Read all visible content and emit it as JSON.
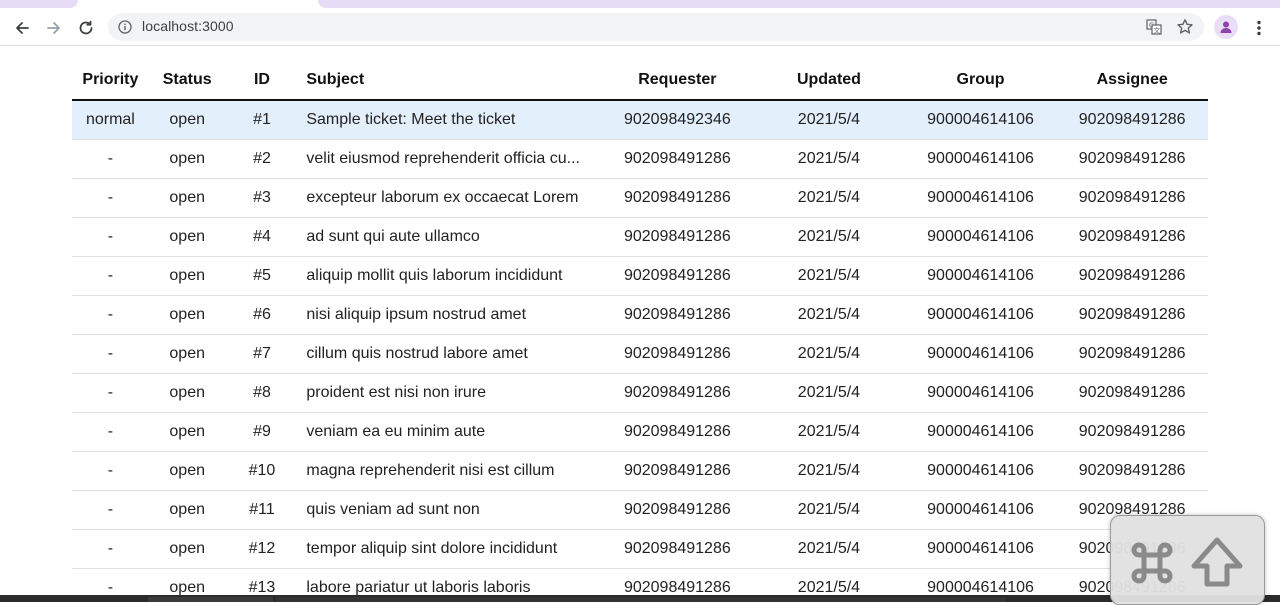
{
  "browser": {
    "url": "localhost:3000",
    "icons": {
      "back": "arrow-left-icon",
      "forward": "arrow-right-icon",
      "reload": "reload-icon",
      "info": "info-icon",
      "translate": "translate-icon",
      "bookmark": "star-icon",
      "profile": "person-icon",
      "menu": "more-vertical-icon"
    }
  },
  "table": {
    "headers": {
      "priority": "Priority",
      "status": "Status",
      "id": "ID",
      "subject": "Subject",
      "requester": "Requester",
      "updated": "Updated",
      "group": "Group",
      "assignee": "Assignee"
    },
    "rows": [
      {
        "priority": "normal",
        "status": "open",
        "id": "#1",
        "subject": "Sample ticket: Meet the ticket",
        "requester": "902098492346",
        "updated": "2021/5/4",
        "group": "900004614106",
        "assignee": "902098491286"
      },
      {
        "priority": "-",
        "status": "open",
        "id": "#2",
        "subject": "velit eiusmod reprehenderit officia cu...",
        "requester": "902098491286",
        "updated": "2021/5/4",
        "group": "900004614106",
        "assignee": "902098491286"
      },
      {
        "priority": "-",
        "status": "open",
        "id": "#3",
        "subject": "excepteur laborum ex occaecat Lorem",
        "requester": "902098491286",
        "updated": "2021/5/4",
        "group": "900004614106",
        "assignee": "902098491286"
      },
      {
        "priority": "-",
        "status": "open",
        "id": "#4",
        "subject": "ad sunt qui aute ullamco",
        "requester": "902098491286",
        "updated": "2021/5/4",
        "group": "900004614106",
        "assignee": "902098491286"
      },
      {
        "priority": "-",
        "status": "open",
        "id": "#5",
        "subject": "aliquip mollit quis laborum incididunt",
        "requester": "902098491286",
        "updated": "2021/5/4",
        "group": "900004614106",
        "assignee": "902098491286"
      },
      {
        "priority": "-",
        "status": "open",
        "id": "#6",
        "subject": "nisi aliquip ipsum nostrud amet",
        "requester": "902098491286",
        "updated": "2021/5/4",
        "group": "900004614106",
        "assignee": "902098491286"
      },
      {
        "priority": "-",
        "status": "open",
        "id": "#7",
        "subject": "cillum quis nostrud labore amet",
        "requester": "902098491286",
        "updated": "2021/5/4",
        "group": "900004614106",
        "assignee": "902098491286"
      },
      {
        "priority": "-",
        "status": "open",
        "id": "#8",
        "subject": "proident est nisi non irure",
        "requester": "902098491286",
        "updated": "2021/5/4",
        "group": "900004614106",
        "assignee": "902098491286"
      },
      {
        "priority": "-",
        "status": "open",
        "id": "#9",
        "subject": "veniam ea eu minim aute",
        "requester": "902098491286",
        "updated": "2021/5/4",
        "group": "900004614106",
        "assignee": "902098491286"
      },
      {
        "priority": "-",
        "status": "open",
        "id": "#10",
        "subject": "magna reprehenderit nisi est cillum",
        "requester": "902098491286",
        "updated": "2021/5/4",
        "group": "900004614106",
        "assignee": "902098491286"
      },
      {
        "priority": "-",
        "status": "open",
        "id": "#11",
        "subject": "quis veniam ad sunt non",
        "requester": "902098491286",
        "updated": "2021/5/4",
        "group": "900004614106",
        "assignee": "902098491286"
      },
      {
        "priority": "-",
        "status": "open",
        "id": "#12",
        "subject": "tempor aliquip sint dolore incididunt",
        "requester": "902098491286",
        "updated": "2021/5/4",
        "group": "900004614106",
        "assignee": "902098491286"
      },
      {
        "priority": "-",
        "status": "open",
        "id": "#13",
        "subject": "labore pariatur ut laboris laboris",
        "requester": "902098491286",
        "updated": "2021/5/4",
        "group": "900004614106",
        "assignee": "902098491286"
      }
    ]
  },
  "overlay": {
    "keys": [
      "command-key-icon",
      "shift-key-icon"
    ]
  },
  "colors": {
    "selected_row": "#e3f0fc",
    "tab_accent": "#e7dcf5",
    "profile_accent": "#8e44ad"
  }
}
